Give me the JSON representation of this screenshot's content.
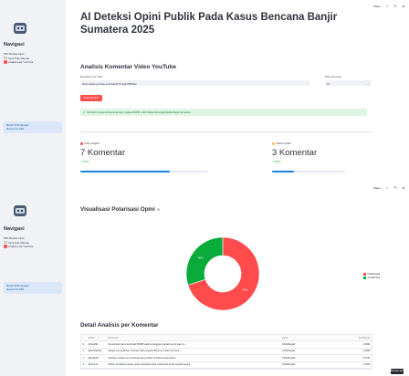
{
  "sidebar": {
    "nav_title": "Navigasi",
    "section_label": "Pilih Metode Input",
    "options": [
      "Input Teks Manual",
      "Analisis Link YouTube"
    ],
    "selected_index": 1,
    "info_text": "Model SVM dengan\nakurasi 91.29%"
  },
  "toolbar": {
    "deploy_label": "Share"
  },
  "page_title": "AI Deteksi Opini Publik Pada Kasus Bencana Banjir Sumatera 2025",
  "youtube_section": {
    "heading": "Analisis Komentar Video YouTube",
    "url_label": "Masukkan Link Video",
    "url_value": "https://www.youtube.com/watch?v=qwHTIBt7kw",
    "max_label": "Maks Komentar",
    "max_value": "10",
    "button_label": "Mulai Analisis",
    "success_text": "Berhasil mengambil komentar dari: Update BNPB: 1.000 Warga Meninggal akibat Banjir Sumatera"
  },
  "metrics": [
    {
      "label": "Kritik / Negatif",
      "value": "7 Komentar",
      "delta": "↑ 70.0%",
      "progress": 0.7,
      "dot_color": "#ff4b4b"
    },
    {
      "label": "Netral / Positif",
      "value": "3 Komentar",
      "delta": "↑ 30.0%",
      "progress": 0.3,
      "dot_color": "#ffbd45"
    }
  ],
  "viz_title": "Visualisasi Polarisasi Opini",
  "chart_data": {
    "type": "pie",
    "donut": true,
    "categories": [
      "Kritik/Negatif",
      "Netral/Positif"
    ],
    "values": [
      70,
      30
    ],
    "slice_labels": [
      "70%",
      "30%"
    ],
    "colors": [
      "#ff4b4b",
      "#09ab3b"
    ],
    "legend_position": "right"
  },
  "table": {
    "title": "Detail Analisis per Komentar",
    "columns": [
      "",
      "Author",
      "Komentar",
      "Label",
      "Confidence"
    ],
    "rows": [
      [
        "0",
        "@trad291",
        "Pemerintah harus bertindak! BNPB wajib bertanggung jawab penuh atas ini...",
        "Kritik/Negatif",
        "0.9961"
      ],
      [
        "1",
        "@Ferdiabu4y",
        "Sangat menyedihkan, bantuan harus segera dikirim ke lokasi bencana...",
        "Kritik/Negatif",
        "0.9948"
      ],
      [
        "2",
        "@sugih09",
        "Pasukan relawan terus bekerja siang malam di lokasi pengungsian",
        "Kritik/Negatif",
        "0.9731"
      ],
      [
        "3",
        "@ozu12a",
        "Mohon perhatikan warga yang terdampak banjir, kebutuhan pokok sangat kurang",
        "Kritik/Negatif",
        "0.9644"
      ]
    ]
  },
  "fab_label": "Manage app"
}
